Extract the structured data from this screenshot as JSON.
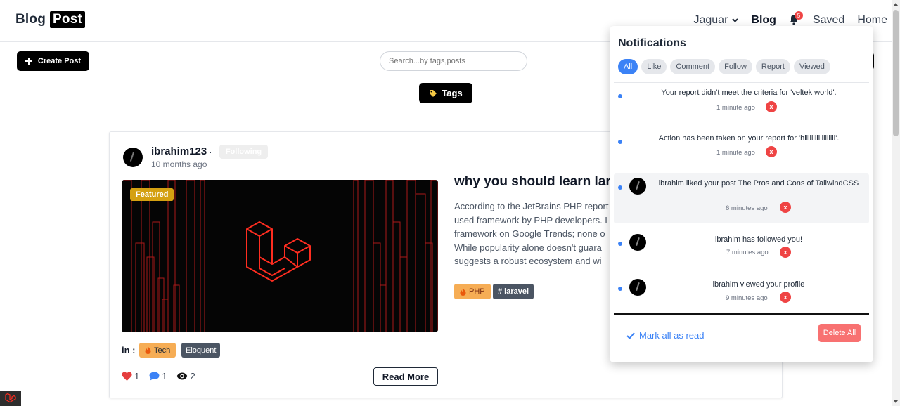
{
  "header": {
    "logo_blog": "Blog",
    "logo_post": "Post",
    "user_name": "Jaguar",
    "nav_blog": "Blog",
    "notification_count": "5",
    "nav_saved": "Saved",
    "nav_home": "Home"
  },
  "toolbar": {
    "create_label": "Create Post",
    "search_placeholder": "Search...by tags,posts",
    "tags_label": "Tags"
  },
  "post": {
    "author": "ibrahim123",
    "separator": "·",
    "follow_label": "Following",
    "time_ago": "10 months ago",
    "featured_label": "Featured",
    "title": "why you should learn lar",
    "excerpt": "According to the JetBrains PHP report used framework by PHP developers. L framework on Google Trends; none o While popularity alone doesn't guara suggests a robust ecosystem and wi",
    "post_tags": [
      "PHP",
      "# laravel"
    ],
    "in_label": "in :",
    "categories": [
      "Tech",
      "Eloquent"
    ],
    "likes": "1",
    "comments": "1",
    "views": "2",
    "read_more": "Read More"
  },
  "notifications": {
    "title": "Notifications",
    "filters": [
      "All",
      "Like",
      "Comment",
      "Follow",
      "Report",
      "Viewed"
    ],
    "active_filter": "All",
    "items": [
      {
        "text": "Your report didn't meet the criteria for 'veltek world'.",
        "time": "1 minute ago",
        "avatar": false
      },
      {
        "text": "Action has been taken on your report for 'hiiiiiiiiiiiiiiiiii'.",
        "time": "1 minute ago",
        "avatar": false
      },
      {
        "text": "ibrahim liked your post The Pros and Cons of TailwindCSS",
        "time": "6 minutes ago",
        "avatar": true
      },
      {
        "text": "ibrahim has followed you!",
        "time": "7 minutes ago",
        "avatar": true
      },
      {
        "text": "ibrahim viewed your profile",
        "time": "9 minutes ago",
        "avatar": true
      }
    ],
    "dismiss_label": "x",
    "mark_all_label": "Mark all as read",
    "delete_all_label": "Delete All"
  },
  "colors": {
    "accent_blue": "#3b82f6",
    "danger_red": "#ef4444",
    "featured_gold": "#d4a011",
    "tag_orange": "#f6ad55",
    "laravel_red": "#ff2d20"
  }
}
